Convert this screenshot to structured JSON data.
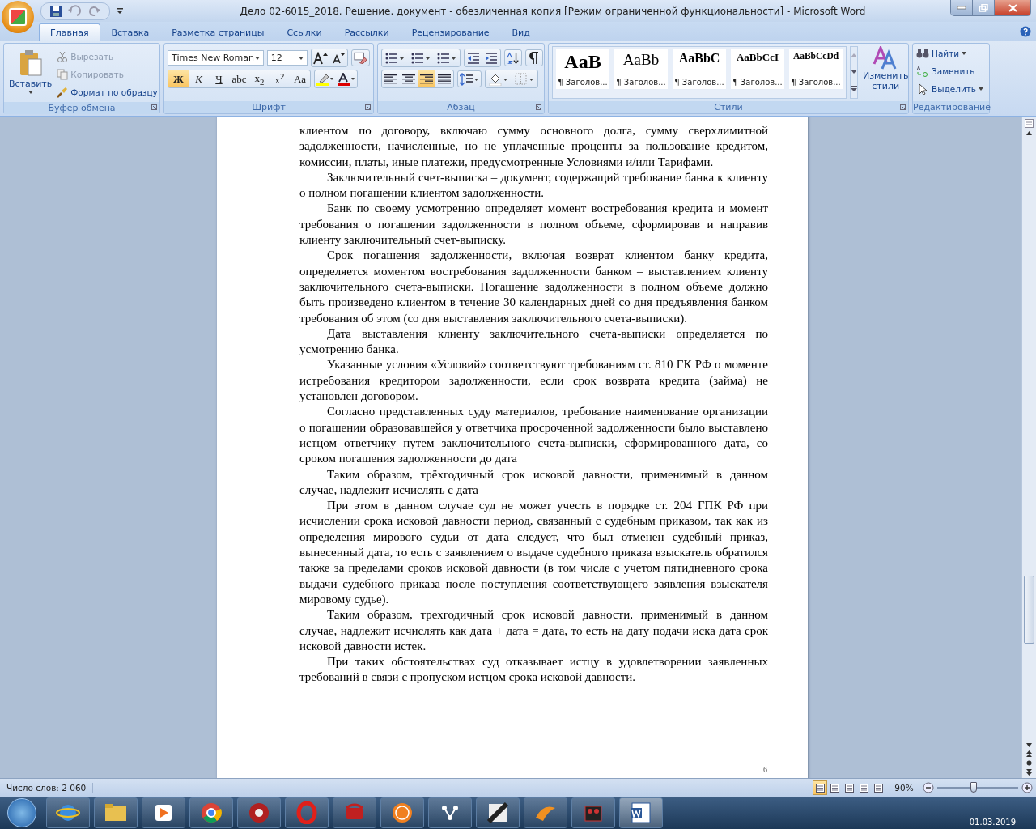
{
  "window": {
    "title": "Дело 02-6015_2018. Решение. документ - обезличенная копия [Режим ограниченной функциональности] - Microsoft Word"
  },
  "tabs": [
    {
      "label": "Главная",
      "selected": true
    },
    {
      "label": "Вставка",
      "selected": false
    },
    {
      "label": "Разметка страницы",
      "selected": false
    },
    {
      "label": "Ссылки",
      "selected": false
    },
    {
      "label": "Рассылки",
      "selected": false
    },
    {
      "label": "Рецензирование",
      "selected": false
    },
    {
      "label": "Вид",
      "selected": false
    }
  ],
  "clipboard": {
    "paste_label": "Вставить",
    "items": [
      {
        "label": "Вырезать",
        "disabled": true
      },
      {
        "label": "Копировать",
        "disabled": true
      },
      {
        "label": "Формат по образцу",
        "disabled": false
      }
    ],
    "group_label": "Буфер обмена"
  },
  "font": {
    "font_name": "Times New Roman",
    "font_size": "12",
    "format_buttons": [
      {
        "label": "Ж",
        "selected": true
      },
      {
        "label": "К",
        "selected": false
      },
      {
        "label": "Ч",
        "selected": false
      },
      {
        "label": "abc",
        "selected": false
      },
      {
        "label": "x$_{2}$",
        "selected": false
      },
      {
        "label": "x$^{2}$",
        "selected": false
      },
      {
        "label": "Aa",
        "selected": false
      }
    ],
    "group_label": "Шрифт"
  },
  "paragraph": {
    "alignment": [
      {
        "selected": false
      },
      {
        "selected": false
      },
      {
        "selected": true
      },
      {
        "selected": false
      }
    ],
    "group_label": "Абзац"
  },
  "styles": {
    "items": [
      {
        "sample": "AaB",
        "label": "¶ Заголов..."
      },
      {
        "sample": "AaBb",
        "label": "¶ Заголов..."
      },
      {
        "sample": "AaBbC",
        "label": "¶ Заголов..."
      },
      {
        "sample": "AaBbCcI",
        "label": "¶ Заголов..."
      },
      {
        "sample": "AaBbCcDd",
        "label": "¶ Заголов..."
      }
    ],
    "change_label": [
      "Изменить",
      "стили"
    ],
    "group_label": "Стили"
  },
  "editing": {
    "items": [
      {
        "label": "Найти",
        "dropdown": true
      },
      {
        "label": "Заменить",
        "dropdown": false
      },
      {
        "label": "Выделить",
        "dropdown": true
      }
    ],
    "group_label": "Редактирование"
  },
  "document": {
    "paragraphs": [
      {
        "first_line_indent": false,
        "text": "клиентом по договору, включаю сумму основного долга, сумму сверхлимитной задолженности, начисленные, но не уплаченные проценты за пользование кредитом, комиссии, платы, иные платежи, предусмотренные Условиями и/или Тарифами."
      },
      {
        "first_line_indent": true,
        "text": "Заключительный счет-выписка – документ, содержащий требование банка к клиенту о полном погашении клиентом задолженности."
      },
      {
        "first_line_indent": true,
        "text": "Банк по своему усмотрению определяет момент востребования кредита и момент требования о погашении задолженности в полном объеме, сформировав и направив клиенту заключительный счет-выписку."
      },
      {
        "first_line_indent": true,
        "text": "Срок погашения задолженности, включая возврат клиентом банку кредита, определяется моментом востребования задолженности банком – выставлением клиенту заключительного счета-выписки. Погашение задолженности в полном объеме должно быть произведено клиентом в течение 30 календарных дней со дня предъявления банком требования об этом (со дня выставления заключительного счета-выписки)."
      },
      {
        "first_line_indent": true,
        "text": "Дата выставления клиенту заключительного счета-выписки определяется по усмотрению банка."
      },
      {
        "first_line_indent": true,
        "text": "Указанные условия «Условий» соответствуют требованиям ст. 810 ГК РФ о моменте истребования кредитором задолженности, если срок возврата кредита (займа) не установлен договором."
      },
      {
        "first_line_indent": true,
        "text": "Согласно представленных суду материалов, требование наименование организации о погашении образовавшейся у ответчика просроченной задолженности было выставлено истцом ответчику путем заключительного счета-выписки, сформированного дата, со сроком погашения задолженности до дата"
      },
      {
        "first_line_indent": true,
        "text": "Таким образом, трёхгодичный срок исковой давности, применимый в данном случае, надлежит исчислять с дата"
      },
      {
        "first_line_indent": true,
        "text": "При этом в данном случае суд не может учесть в порядке ст. 204 ГПК РФ при исчислении срока исковой давности период, связанный с судебным приказом, так как из определения мирового судьи от дата следует, что был отменен судебный приказ, вынесенный дата, то есть с заявлением о выдаче судебного приказа взыскатель обратился также за пределами сроков исковой давности (в том числе с учетом пятидневного срока выдачи судебного приказа после поступления соответствующего заявления взыскателя мировому судье)."
      },
      {
        "first_line_indent": true,
        "text": "Таким образом, трехгодичный срок исковой давности, применимый в данном случае, надлежит исчислять как дата + дата = дата, то есть на дату подачи иска дата срок исковой давности истек."
      },
      {
        "first_line_indent": true,
        "text": "При таких обстоятельствах суд отказывает истцу в удовлетворении заявленных требований в связи с пропуском истцом срока исковой давности."
      }
    ],
    "page_number": "6"
  },
  "status_bar": {
    "word_count": "Число слов: 2 060",
    "views": [
      {
        "selected": true
      },
      {
        "selected": false
      },
      {
        "selected": false
      },
      {
        "selected": false
      },
      {
        "selected": false
      }
    ],
    "zoom": "90%",
    "zoom_slider": {
      "level": 0.45
    }
  },
  "taskbar": {
    "date": "01.03.2019"
  }
}
